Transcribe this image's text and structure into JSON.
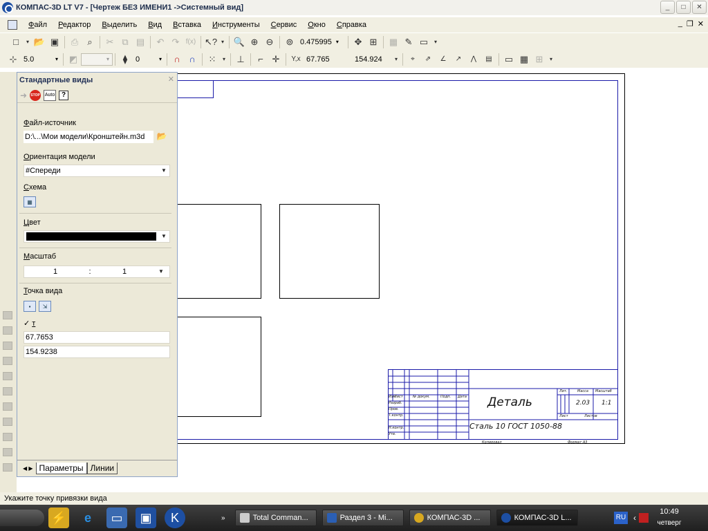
{
  "window": {
    "title": "КОМПАС-3D LT V7 - [Чертеж БЕЗ ИМЕНИ1 ->Системный вид]"
  },
  "menu": {
    "items": [
      "Файл",
      "Редактор",
      "Выделить",
      "Вид",
      "Вставка",
      "Инструменты",
      "Сервис",
      "Окно",
      "Справка"
    ]
  },
  "toolbar": {
    "zoom_value": "0.475995",
    "step_value": "5.0",
    "layer_value": "0",
    "coord_x": "67.765",
    "coord_y": "154.924"
  },
  "panel": {
    "title": "Стандартные виды",
    "auto_label": "Auto",
    "source_label": "Файл-источник",
    "source_value": "D:\\...\\Мои модели\\Кронштейн.m3d",
    "orientation_label": "Ориентация модели",
    "orientation_value": "#Спереди",
    "scheme_label": "Схема",
    "color_label": "Цвет",
    "scale_label": "Масштаб",
    "scale_num": "1",
    "scale_sep": ":",
    "scale_den": "1",
    "viewpoint_label": "Точка вида",
    "t_label": "т",
    "x_value": "67.7653",
    "y_value": "154.9238",
    "tabs": [
      "Параметры",
      "Линии"
    ]
  },
  "stamp": {
    "part_name": "Деталь",
    "material": "Сталь 10 ГОСТ 1050-88",
    "mass": "2.03",
    "scale": "1:1",
    "lit": "Лит.",
    "massa": "Масса",
    "masshtab": "Масштаб",
    "list": "Лист",
    "listov": "Листов",
    "copied": "Копировал",
    "format": "Формат А3",
    "rows": [
      "Изм.",
      "Лист",
      "№ докум.",
      "Подп.",
      "Дата",
      "Разраб.",
      "Пров.",
      "Т.контр.",
      "Н.контр.",
      "Утв."
    ]
  },
  "status": {
    "message": "Укажите точку привязки вида"
  },
  "taskbar": {
    "buttons": [
      "Total Comman...",
      "Раздел 3 - Mi...",
      "КОМПАС-3D ...",
      "КОМПАС-3D L..."
    ],
    "lang": "RU",
    "time": "10:49",
    "day": "четверг"
  }
}
